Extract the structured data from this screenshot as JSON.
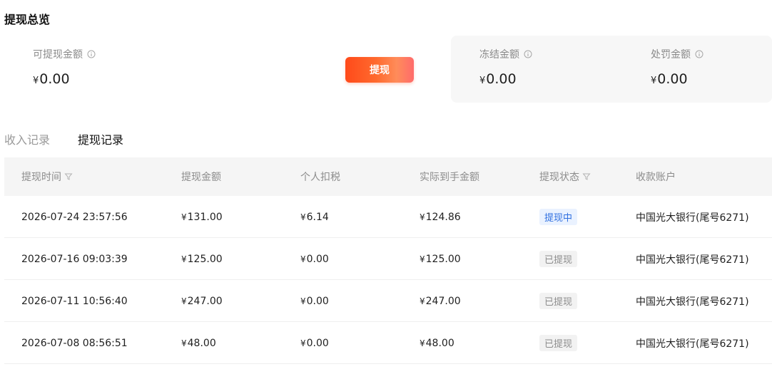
{
  "overview": {
    "title": "提现总览",
    "available": {
      "label": "可提现金额",
      "currency": "¥",
      "amount": "0.00"
    },
    "withdraw_button": "提现",
    "frozen": {
      "label": "冻结金额",
      "currency": "¥",
      "amount": "0.00"
    },
    "penalty": {
      "label": "处罚金额",
      "currency": "¥",
      "amount": "0.00"
    }
  },
  "tabs": [
    {
      "label": "收入记录",
      "active": false
    },
    {
      "label": "提现记录",
      "active": true
    }
  ],
  "table": {
    "columns": [
      "提现时间",
      "提现金额",
      "个人扣税",
      "实际到手金额",
      "提现状态",
      "收款账户"
    ],
    "rows": [
      {
        "time": "2026-07-24 23:57:56",
        "amount": "131.00",
        "tax": "6.14",
        "net": "124.86",
        "status": "提现中",
        "account": "中国光大银行(尾号6271)"
      },
      {
        "time": "2026-07-16 09:03:39",
        "amount": "125.00",
        "tax": "0.00",
        "net": "125.00",
        "status": "已提现",
        "account": "中国光大银行(尾号6271)"
      },
      {
        "time": "2026-07-11 10:56:40",
        "amount": "247.00",
        "tax": "0.00",
        "net": "247.00",
        "status": "已提现",
        "account": "中国光大银行(尾号6271)"
      },
      {
        "time": "2026-07-08 08:56:51",
        "amount": "48.00",
        "tax": "0.00",
        "net": "48.00",
        "status": "已提现",
        "account": "中国光大银行(尾号6271)"
      }
    ],
    "currency": "¥"
  },
  "colors": {
    "accent": "#ff4a1a",
    "processing_badge": "#2f6fe0",
    "done_badge": "#8c8c8c"
  },
  "icons": {
    "info": "info-icon",
    "filter": "filter-icon"
  }
}
